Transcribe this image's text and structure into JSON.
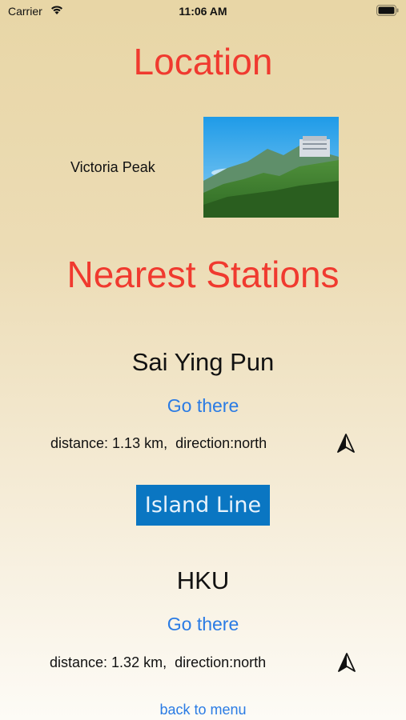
{
  "status_bar": {
    "carrier": "Carrier",
    "time": "11:06 AM",
    "icons": [
      "wifi-icon",
      "battery-icon"
    ]
  },
  "header": {
    "title": "Location"
  },
  "location": {
    "name": "Victoria Peak",
    "photo": "victoria-peak-photo"
  },
  "stations_section": {
    "title": "Nearest Stations"
  },
  "stations": [
    {
      "name": "Sai Ying Pun",
      "action_label": "Go there",
      "distance_text": "distance: 1.13 km,  direction:north",
      "direction_icon": "navigation-arrow-icon"
    },
    {
      "name": "HKU",
      "action_label": "Go there",
      "distance_text": "distance: 1.32 km,  direction:north",
      "direction_icon": "navigation-arrow-icon"
    }
  ],
  "line_badge": {
    "label": "Island Line",
    "color": "#0a76c2"
  },
  "footer": {
    "back_label": "back to menu"
  },
  "colors": {
    "title": "#f03a2f",
    "link": "#2a7be4"
  }
}
